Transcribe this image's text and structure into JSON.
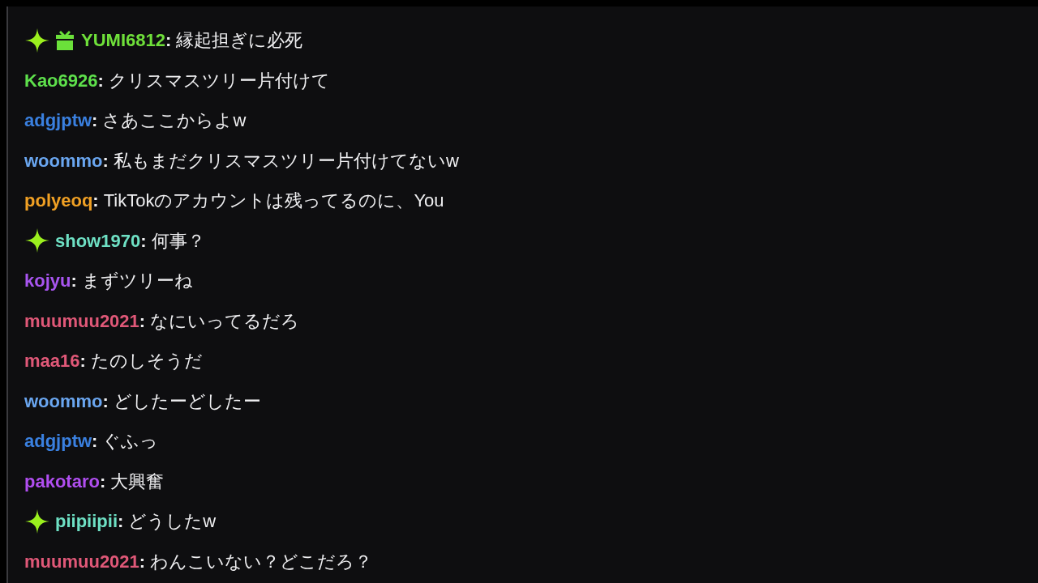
{
  "messages": [
    {
      "badges": [
        {
          "kind": "sparkle"
        },
        {
          "kind": "gift"
        }
      ],
      "user": "YUMI6812",
      "color": "#6fe03a",
      "separator": ":",
      "text": "縁起担ぎに必死"
    },
    {
      "user": "Kao6926",
      "color": "#5ee04c",
      "separator": ":",
      "text": "クリスマスツリー片付けて"
    },
    {
      "user": "adgjptw",
      "color": "#3a80e0",
      "separator": ":",
      "text": "さあここからよw"
    },
    {
      "user": "woommo",
      "color": "#6aa6f0",
      "separator": ":",
      "text": "私もまだクリスマスツリー片付けてないw"
    },
    {
      "user": "polyeoq",
      "color": "#f0a024",
      "separator": ":",
      "text": "TikTokのアカウントは残ってるのに、You"
    },
    {
      "badges": [
        {
          "kind": "sparkle"
        }
      ],
      "user": "show1970",
      "color": "#6ee0c4",
      "separator": ":",
      "text": "何事？"
    },
    {
      "user": "kojyu",
      "color": "#a855f0",
      "separator": ":",
      "text": "まずツリーね"
    },
    {
      "user": "muumuu2021",
      "color": "#e05878",
      "separator": ":",
      "text": "なにいってるだろ"
    },
    {
      "user": "maa16",
      "color": "#e05878",
      "separator": ":",
      "text": "たのしそうだ"
    },
    {
      "user": "woommo",
      "color": "#6aa6f0",
      "separator": ":",
      "text": "どしたーどしたー"
    },
    {
      "user": "adgjptw",
      "color": "#3a80e0",
      "separator": ":",
      "text": "ぐふっ"
    },
    {
      "user": "pakotaro",
      "color": "#b04ef0",
      "separator": ":",
      "text": "大興奮"
    },
    {
      "badges": [
        {
          "kind": "sparkle"
        }
      ],
      "user": "piipiipii",
      "color": "#6ee0c4",
      "separator": ":",
      "text": "どうしたw"
    },
    {
      "user": "muumuu2021",
      "color": "#e05878",
      "separator": ":",
      "text": "わんこいない？どこだろ？"
    }
  ]
}
